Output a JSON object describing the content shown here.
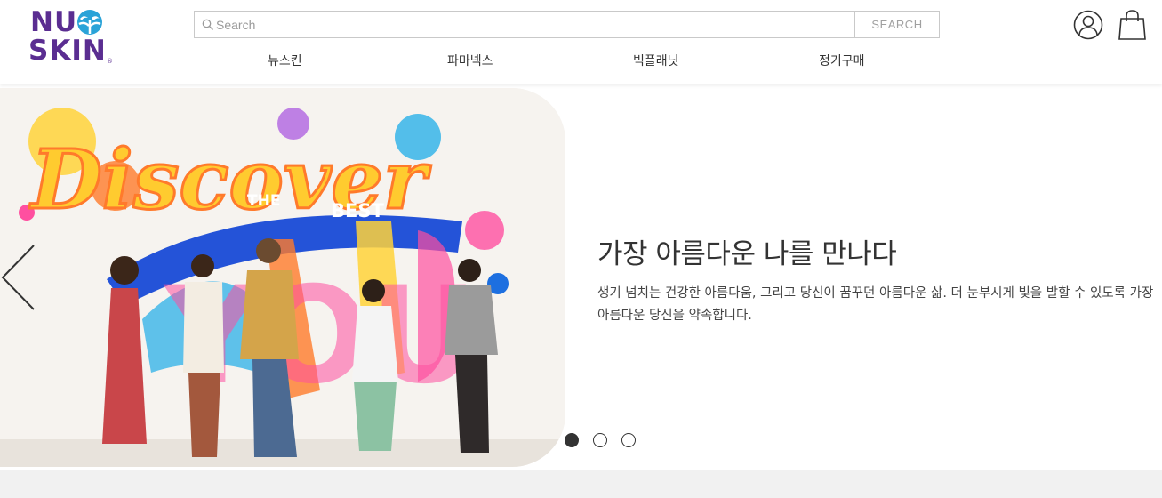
{
  "brand": {
    "logo_line1": "NU",
    "logo_line2": "SKIN",
    "logo_reg": "®",
    "color": "#5a2d91",
    "accent": "#2aa3d8"
  },
  "search": {
    "placeholder": "Search",
    "value": "",
    "button_label": "SEARCH"
  },
  "nav": {
    "items": [
      {
        "label": "뉴스킨"
      },
      {
        "label": "파마넥스"
      },
      {
        "label": "빅플래닛"
      },
      {
        "label": "정기구매"
      }
    ]
  },
  "icons": {
    "account": "account-icon",
    "bag": "shopping-bag-icon",
    "search": "search-icon",
    "prev": "chevron-left-icon"
  },
  "hero": {
    "title": "가장 아름다운 나를 만나다",
    "description": "생기 넘치는 건강한 아름다움, 그리고 당신이 꿈꾸던 아름다운 삶. 더 눈부시게 빛을 발할 수 있도록 가장 아름다운 당신을 약속합니다.",
    "mural_word1": "Discover",
    "mural_word2": "THE",
    "mural_word3": "BEST",
    "mural_word4": "YOU",
    "slides_total": 3,
    "active_slide": 1
  }
}
